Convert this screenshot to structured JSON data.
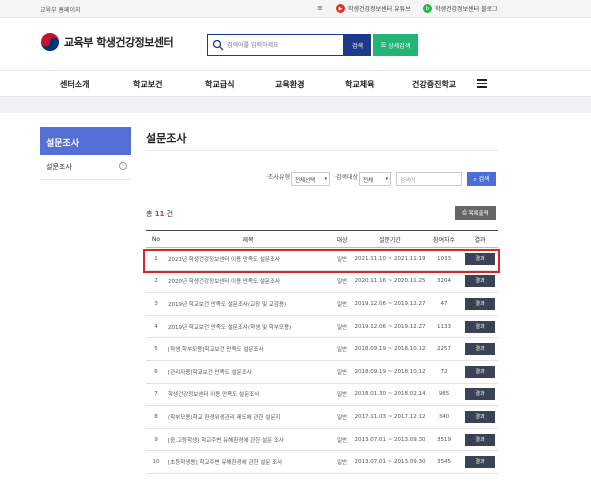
{
  "topbar": {
    "ministry": "교육부 홈페이지",
    "youtube": "학생건강정보센터 유튜브",
    "blog": "학생건강정보센터 블로그"
  },
  "header": {
    "logo": "교육부 학생건강정보센터",
    "search_placeholder": "검색어를 입력하세요",
    "search_btn": "검색",
    "detail_btn": "상세검색"
  },
  "nav": [
    "센터소개",
    "학교보건",
    "학교급식",
    "교육환경",
    "학교체육",
    "건강증진학교"
  ],
  "sidebar": {
    "title": "설문조사",
    "item": "설문조사"
  },
  "main": {
    "title": "설문조사",
    "filter": {
      "type_label": "·조사유형",
      "type_value": "전체선택",
      "target_label": "·검색대상",
      "target_value": "전체",
      "keyword_placeholder": "검색어",
      "button": "검색"
    },
    "count_prefix": "총",
    "count_num": "11",
    "count_suffix": "건",
    "print_btn": "목록출력",
    "columns": [
      "No",
      "제목",
      "대상",
      "설문기간",
      "참여자수",
      "결과"
    ],
    "rows": [
      {
        "no": "1",
        "title": "2021년 학생건강정보센터 이용 만족도 설문조사",
        "target": "일반",
        "period": "2021.11.10 ~ 2021.11.19",
        "count": "1033",
        "result": "결과"
      },
      {
        "no": "2",
        "title": "2020년 학생건강정보센터 이용 만족도 설문조사",
        "target": "일반",
        "period": "2020.11.16 ~ 2020.11.25",
        "count": "3204",
        "result": "결과"
      },
      {
        "no": "3",
        "title": "2019년 학교보건 만족도 설문조사(교장 및 교감용)",
        "target": "일반",
        "period": "2019.12.06 ~ 2019.12.27",
        "count": "47",
        "result": "결과"
      },
      {
        "no": "4",
        "title": "2019년 학교보건 만족도 설문조사(학생 및 학부모용)",
        "target": "일반",
        "period": "2019.12.06 ~ 2019.12.27",
        "count": "1133",
        "result": "결과"
      },
      {
        "no": "5",
        "title": "[학생,학부모용]학교보건 만족도 설문조사",
        "target": "일반",
        "period": "2018.09.19 ~ 2018.10.12",
        "count": "2257",
        "result": "결과"
      },
      {
        "no": "6",
        "title": "[관리자용]학교보건 만족도 설문조사",
        "target": "일반",
        "period": "2018.09.19 ~ 2018.10.12",
        "count": "72",
        "result": "결과"
      },
      {
        "no": "7",
        "title": "학생건강정보센터 이용 만족도 설문조사",
        "target": "일반",
        "period": "2018.01.30 ~ 2018.02.14",
        "count": "985",
        "result": "결과"
      },
      {
        "no": "8",
        "title": "(학부모용)학교 환경위생관리 제도에 관한 설문지",
        "target": "일반",
        "period": "2017.11.03 ~ 2017.12.12",
        "count": "340",
        "result": "결과"
      },
      {
        "no": "9",
        "title": "[중,고등학생] 학교주변 유해환경에 관한 설문 조사",
        "target": "일반",
        "period": "2013.07.01 ~ 2013.09.30",
        "count": "3519",
        "result": "결과"
      },
      {
        "no": "10",
        "title": "[초등학생용] 학교주변 유해환경에 관한 설문 조사",
        "target": "일반",
        "period": "2013.07.01 ~ 2013.09.30",
        "count": "3545",
        "result": "결과"
      }
    ]
  },
  "colors": {
    "primary": "#1e3a8a",
    "sidebar": "#5470d6",
    "green": "#22b573",
    "highlight": "#d62828"
  }
}
